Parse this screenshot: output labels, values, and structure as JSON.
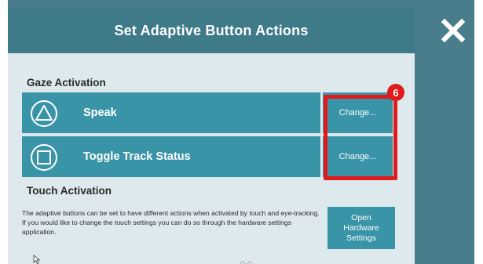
{
  "window": {
    "title": "Set Adaptive Button Actions",
    "close_icon": "close-icon"
  },
  "gaze": {
    "heading": "Gaze Activation",
    "actions": [
      {
        "label": "Speak",
        "icon": "triangle-icon",
        "change_label": "Change..."
      },
      {
        "label": "Toggle Track Status",
        "icon": "square-icon",
        "change_label": "Change..."
      }
    ]
  },
  "touch": {
    "heading": "Touch Activation",
    "description": "The adaptive buttons can be set to have different actions when activated by touch and eye-tracking. If you would like to change the touch settings you can do so through the hardware settings application.",
    "hardware_button": "Open Hardware Settings"
  },
  "annotation": {
    "step_number": "6",
    "color": "#e01a1a"
  },
  "colors": {
    "header": "#3f7a89",
    "panel": "#dde9ec",
    "button": "#3a94a8",
    "backdrop": "#4a7d8c"
  }
}
